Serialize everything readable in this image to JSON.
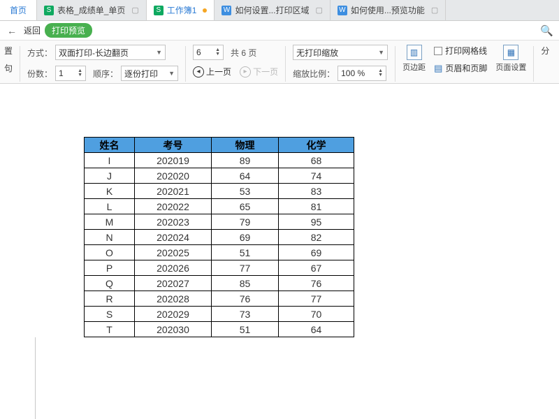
{
  "tabs": {
    "home": "首页",
    "items": [
      {
        "icon": "S",
        "label": "表格_成绩单_单页"
      },
      {
        "icon": "S",
        "label": "工作簿1",
        "active": true,
        "modified": true
      },
      {
        "icon": "W",
        "label": "如何设置...打印区域"
      },
      {
        "icon": "W",
        "label": "如何使用...预览功能"
      }
    ]
  },
  "returnbar": {
    "back": "返回",
    "title": "打印预览"
  },
  "toolbar": {
    "left_trunc1": "置",
    "left_trunc2": "句",
    "mode_label": "方式：",
    "mode_value": "双面打印-长边翻页",
    "copies_label": "份数：",
    "copies_value": "1",
    "order_label": "顺序：",
    "order_value": "逐份打印",
    "page_value": "6",
    "page_total": "共 6 页",
    "prev": "上一页",
    "next": "下一页",
    "zoom_value": "无打印缩放",
    "zoom_ratio_label": "缩放比例：",
    "zoom_ratio_value": "100 %",
    "margins": "页边距",
    "gridlines": "打印网格线",
    "header_footer": "页眉和页脚",
    "page_setup": "页面设置",
    "right_trunc": "分"
  },
  "table": {
    "headers": [
      "姓名",
      "考号",
      "物理",
      "化学"
    ],
    "rows": [
      [
        "I",
        "202019",
        "89",
        "68"
      ],
      [
        "J",
        "202020",
        "64",
        "74"
      ],
      [
        "K",
        "202021",
        "53",
        "83"
      ],
      [
        "L",
        "202022",
        "65",
        "81"
      ],
      [
        "M",
        "202023",
        "79",
        "95"
      ],
      [
        "N",
        "202024",
        "69",
        "82"
      ],
      [
        "O",
        "202025",
        "51",
        "69"
      ],
      [
        "P",
        "202026",
        "77",
        "67"
      ],
      [
        "Q",
        "202027",
        "85",
        "76"
      ],
      [
        "R",
        "202028",
        "76",
        "77"
      ],
      [
        "S",
        "202029",
        "73",
        "70"
      ],
      [
        "T",
        "202030",
        "51",
        "64"
      ]
    ]
  }
}
